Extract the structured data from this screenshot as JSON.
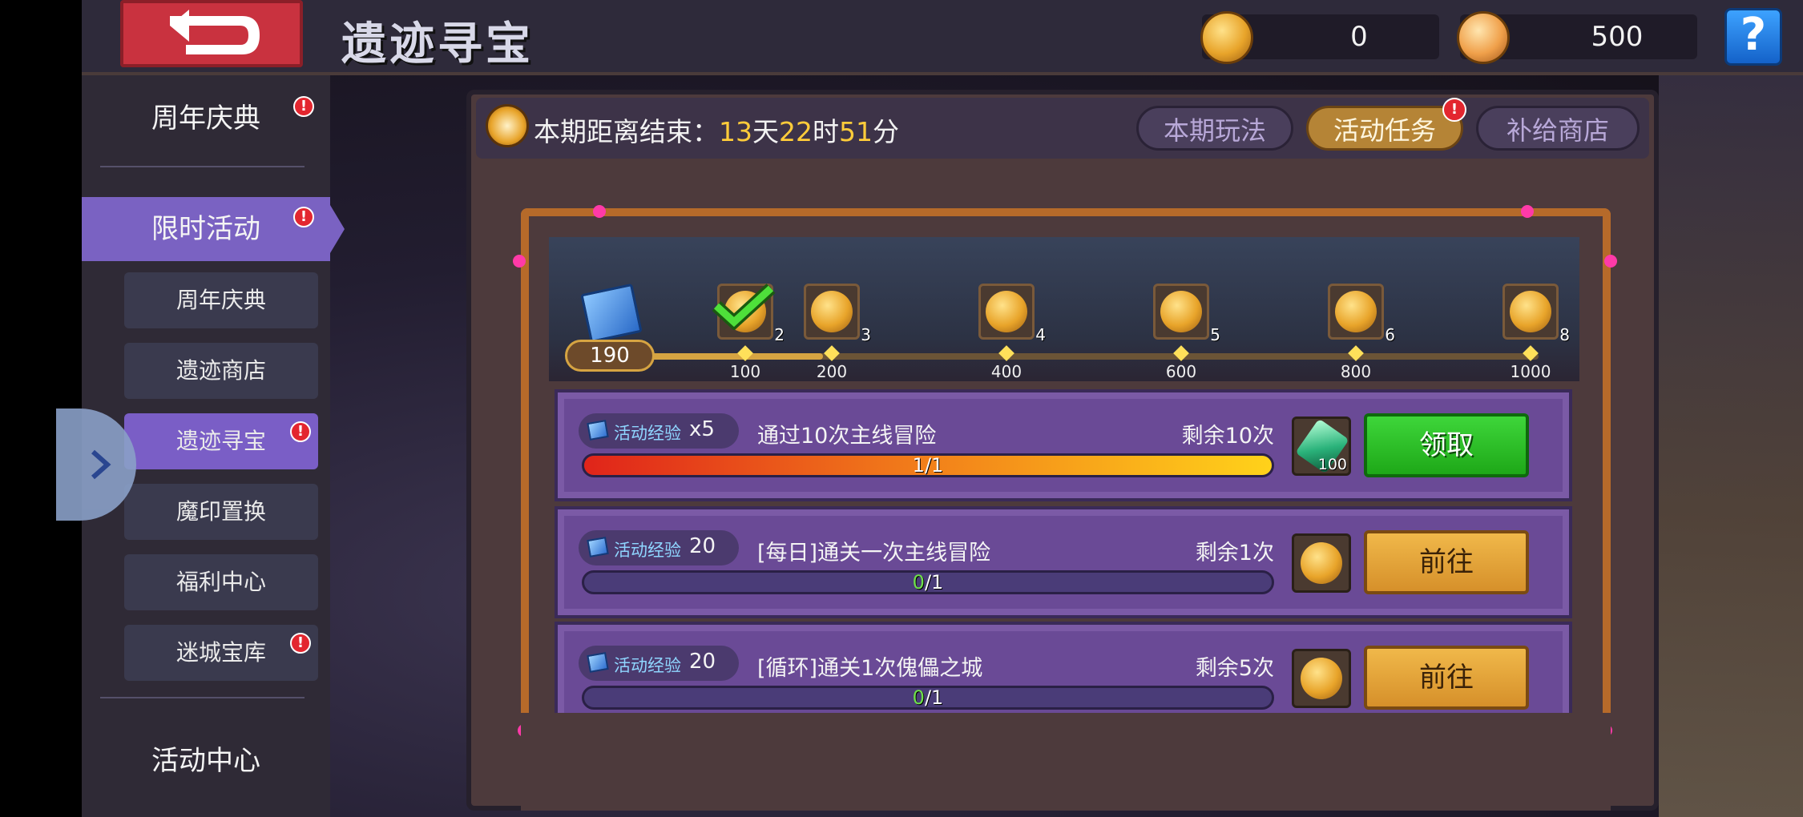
{
  "header": {
    "title": "遗迹寻宝",
    "currency_1": "0",
    "currency_2": "500",
    "help": "?"
  },
  "sidebar": {
    "top": "周年庆典",
    "section": "限时活动",
    "items": [
      {
        "label": "周年庆典",
        "badge": false
      },
      {
        "label": "遗迹商店",
        "badge": false
      },
      {
        "label": "遗迹寻宝",
        "badge": true
      },
      {
        "label": "魔印置换",
        "badge": false
      },
      {
        "label": "福利中心",
        "badge": false
      },
      {
        "label": "迷城宝库",
        "badge": true
      }
    ],
    "bottom": "活动中心",
    "badge_mark": "!"
  },
  "timer": {
    "prefix": "本期距离结束：",
    "days": "13",
    "day_unit": "天",
    "hours": "22",
    "hour_unit": "时",
    "minutes": "51",
    "minute_unit": "分"
  },
  "tabs": [
    {
      "label": "本期玩法",
      "active": false
    },
    {
      "label": "活动任务",
      "active": true
    },
    {
      "label": "补给商店",
      "active": false
    }
  ],
  "progress": {
    "current_exp": "190",
    "current_value": 190,
    "max_value": 1000,
    "milestones": [
      {
        "threshold": "100",
        "reward_count": "2",
        "claimed": true
      },
      {
        "threshold": "200",
        "reward_count": "3",
        "claimed": false
      },
      {
        "threshold": "400",
        "reward_count": "4",
        "claimed": false
      },
      {
        "threshold": "600",
        "reward_count": "5",
        "claimed": false
      },
      {
        "threshold": "800",
        "reward_count": "6",
        "claimed": false
      },
      {
        "threshold": "1000",
        "reward_count": "8",
        "claimed": false
      }
    ]
  },
  "tasks": [
    {
      "exp_label": "活动经验",
      "exp_amount": "x5",
      "name": "通过10次主线冒险",
      "remaining": "剩余10次",
      "progress_current": "1",
      "progress_total": "/1",
      "progress_fraction": 1,
      "reward_icon": "green-crystal-icon",
      "reward_qty": "100",
      "action": "领取",
      "action_type": "claim"
    },
    {
      "exp_label": "活动经验",
      "exp_amount": "20",
      "name": "[每日]通关一次主线冒险",
      "remaining": "剩余1次",
      "progress_current": "0",
      "progress_total": "/1",
      "progress_fraction": 0,
      "reward_icon": "gold-coin-icon",
      "reward_qty": "",
      "action": "前往",
      "action_type": "goto"
    },
    {
      "exp_label": "活动经验",
      "exp_amount": "20",
      "name": "[循环]通关1次傀儡之城",
      "remaining": "剩余5次",
      "progress_current": "0",
      "progress_total": "/1",
      "progress_fraction": 0,
      "reward_icon": "gold-coin-icon",
      "reward_qty": "",
      "action": "前往",
      "action_type": "goto"
    }
  ],
  "colors": {
    "accent_purple": "#7a62c2",
    "gold": "#e8a42a",
    "claim_green": "#1ea818",
    "alert_red": "#e3262f",
    "timer_highlight": "#ffcc3a"
  }
}
